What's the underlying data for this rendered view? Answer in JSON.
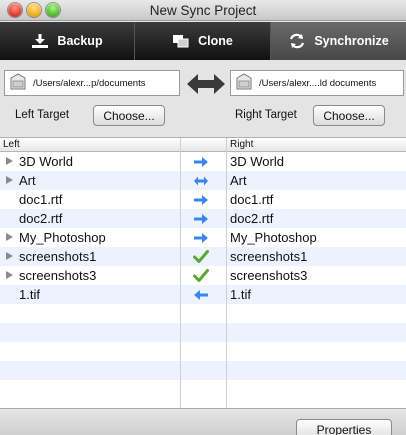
{
  "window": {
    "title": "New Sync Project"
  },
  "modes": [
    {
      "label": "Backup",
      "icon": "backup-download-icon",
      "selected": false
    },
    {
      "label": "Clone",
      "icon": "clone-icon",
      "selected": false
    },
    {
      "label": "Synchronize",
      "icon": "sync-icon",
      "selected": true
    }
  ],
  "paths": {
    "left": "/Users/alexr...p/documents",
    "right": "/Users/alexr....ld documents",
    "direction_icon": "bidirectional-arrow-icon"
  },
  "targets": {
    "left_label": "Left Target",
    "right_label": "Right Target",
    "choose_label": "Choose..."
  },
  "table": {
    "headers": {
      "left": "Left",
      "right": "Right"
    },
    "rows": [
      {
        "left": "3D World",
        "right": "3D World",
        "folder": true,
        "status": "arrow-right"
      },
      {
        "left": "Art",
        "right": "Art",
        "folder": true,
        "status": "arrow-both"
      },
      {
        "left": "doc1.rtf",
        "right": "doc1.rtf",
        "folder": false,
        "status": "arrow-right"
      },
      {
        "left": "doc2.rtf",
        "right": "doc2.rtf",
        "folder": false,
        "status": "arrow-right"
      },
      {
        "left": "My_Photoshop",
        "right": "My_Photoshop",
        "folder": true,
        "status": "arrow-right"
      },
      {
        "left": "screenshots1",
        "right": "screenshots1",
        "folder": true,
        "status": "check"
      },
      {
        "left": "screenshots3",
        "right": "screenshots3",
        "folder": true,
        "status": "check"
      },
      {
        "left": "1.tif",
        "right": "1.tif",
        "folder": false,
        "status": "arrow-left"
      }
    ],
    "empty_rows": 5
  },
  "footer": {
    "properties_label": "Properties"
  },
  "colors": {
    "arrow": "#3a86f0",
    "check": "#5aa832",
    "alt_row": "#edf3fe"
  }
}
